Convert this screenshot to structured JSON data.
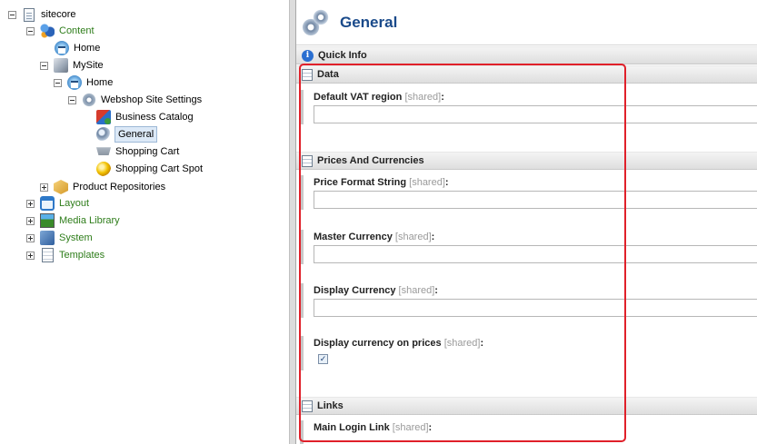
{
  "tree": {
    "root": "sitecore",
    "content": "Content",
    "home1": "Home",
    "mysite": "MySite",
    "home2": "Home",
    "webshop": "Webshop Site Settings",
    "business_catalog": "Business Catalog",
    "general": "General",
    "shopping_cart": "Shopping Cart",
    "shopping_cart_spot": "Shopping Cart Spot",
    "product_repositories": "Product Repositories",
    "layout": "Layout",
    "media_library": "Media Library",
    "system": "System",
    "templates": "Templates",
    "selected_item": "General"
  },
  "editor": {
    "title": "General",
    "quick_info": "Quick Info",
    "sections": {
      "data": "Data",
      "prices": "Prices And Currencies",
      "links": "Links"
    },
    "shared_tag": "[shared]",
    "colon": ":",
    "fields": {
      "default_vat": {
        "label": "Default VAT region",
        "value": ""
      },
      "price_format": {
        "label": "Price Format String",
        "value": ""
      },
      "master_currency": {
        "label": "Master Currency",
        "value": ""
      },
      "display_currency": {
        "label": "Display Currency",
        "value": ""
      },
      "display_on_prices": {
        "label": "Display currency on prices",
        "checked": true,
        "check_glyph": "✓"
      },
      "main_login_link": {
        "label": "Main Login Link"
      }
    }
  },
  "colors": {
    "title": "#1a4a8a",
    "green_item": "#2e7d1a",
    "highlight": "#e0202a"
  }
}
